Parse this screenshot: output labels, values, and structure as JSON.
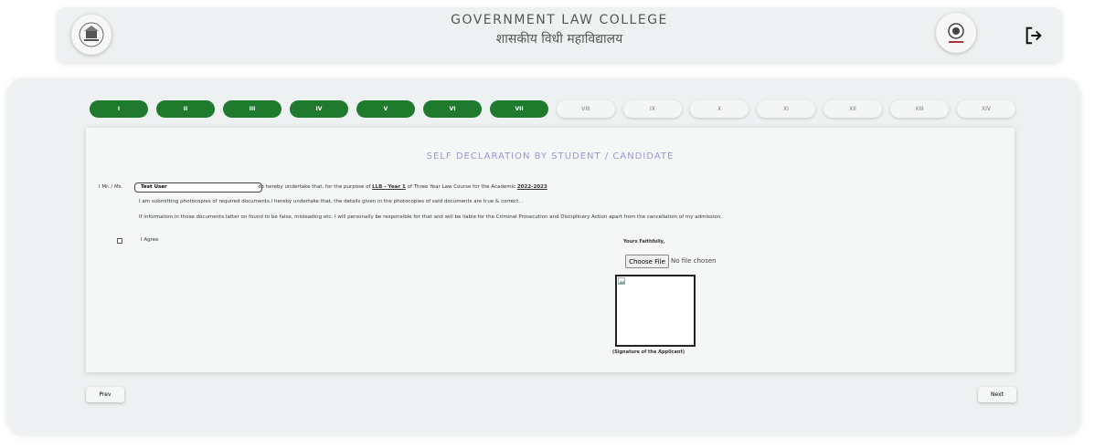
{
  "header": {
    "title_en": "GOVERNMENT LAW COLLEGE",
    "title_hi": "शासकीय विधी महाविद्यालय",
    "left_logo_icon": "college-seal-icon",
    "right_logo_icon": "maharashtra-emblem-icon",
    "logout_icon": "logout-icon"
  },
  "steps": [
    {
      "label": "I",
      "active": true
    },
    {
      "label": "II",
      "active": true
    },
    {
      "label": "III",
      "active": true
    },
    {
      "label": "IV",
      "active": true
    },
    {
      "label": "V",
      "active": true
    },
    {
      "label": "VI",
      "active": true
    },
    {
      "label": "VII",
      "active": true
    },
    {
      "label": "VIII",
      "active": false
    },
    {
      "label": "IX",
      "active": false
    },
    {
      "label": "X",
      "active": false
    },
    {
      "label": "XI",
      "active": false
    },
    {
      "label": "XII",
      "active": false
    },
    {
      "label": "XIII",
      "active": false
    },
    {
      "label": "XIV",
      "active": false
    }
  ],
  "colors": {
    "active_step": "#1f7a2e",
    "heading": "#9b94d4"
  },
  "form": {
    "heading": "SELF DECLARATION BY STUDENT / CANDIDATE",
    "prefix": "I Mr. / Ms.",
    "name_value": "Test User",
    "undertake_text": "do hereby undertake that, for the purpose of",
    "course": "LLB - Year 1",
    "course_suffix": "of Three Year Law Course for the Academic",
    "academic_year": "2022-2023",
    "line2": "I am submitting photocopies of required documents.I hereby undertake that, the details given in the photocopies of said documents are true & correct. .",
    "line3": "If information in those documents latter on found to be false, misleading etc. I will personally be responsible for that and will be liable for the Criminal Prosecution and Disciplinary Action apart from the cancellation of my admission.",
    "agree_label": "I Agree",
    "yours_faithfully": "Yours Faithfully,",
    "choose_file_label": "Choose File",
    "no_file_text": "No file chosen",
    "signature_caption": "(Signature of the Applicant)"
  },
  "nav": {
    "prev_label": "Prev",
    "next_label": "Next"
  }
}
